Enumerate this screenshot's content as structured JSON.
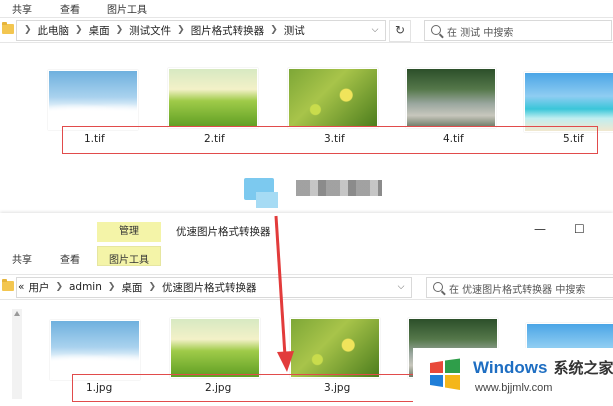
{
  "top_window": {
    "ribbon_tabs": [
      "共享",
      "查看",
      "图片工具"
    ],
    "breadcrumb": [
      "此电脑",
      "桌面",
      "测试文件",
      "图片格式转换器",
      "测试"
    ],
    "search_placeholder": "在 测试 中搜索",
    "files": [
      {
        "name": "1.tif",
        "thumb": "sky-clouds"
      },
      {
        "name": "2.tif",
        "thumb": "green-meadow"
      },
      {
        "name": "3.tif",
        "thumb": "yellow-flowers"
      },
      {
        "name": "4.tif",
        "thumb": "forest-river"
      },
      {
        "name": "5.tif",
        "thumb": "tropical-beach"
      }
    ]
  },
  "bottom_window": {
    "context_tab": "管理",
    "context_title": "优速图片格式转换器",
    "ribbon_tabs": [
      "共享",
      "查看",
      "图片工具"
    ],
    "window_controls": {
      "minimize": "—",
      "maximize": "☐"
    },
    "breadcrumb_overflow": "«",
    "breadcrumb": [
      "用户",
      "admin",
      "桌面",
      "优速图片格式转换器"
    ],
    "search_placeholder": "在 优速图片格式转换器 中搜索",
    "files": [
      {
        "name": "1.jpg",
        "thumb": "sky-clouds"
      },
      {
        "name": "2.jpg",
        "thumb": "green-meadow"
      },
      {
        "name": "3.jpg",
        "thumb": "yellow-flowers"
      }
    ]
  },
  "watermark": {
    "brand": "Windows",
    "suffix": "系统之家",
    "url": "www.bjjmlv.com"
  },
  "colors": {
    "highlight_frame": "#e14b4b",
    "context_tab": "#f4f4a8",
    "brand_blue": "#1e6ec2"
  }
}
